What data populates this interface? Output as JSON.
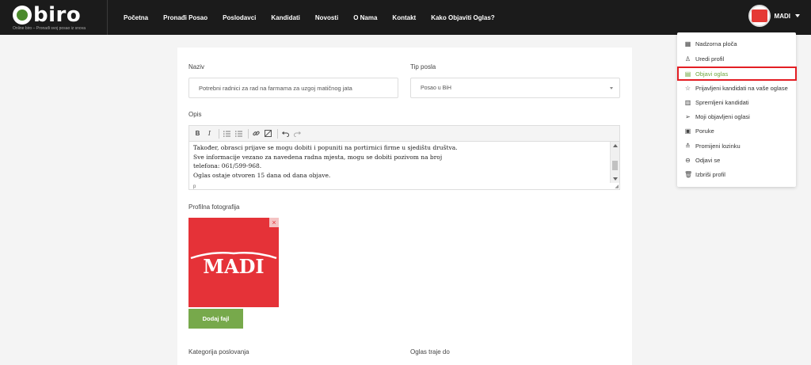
{
  "brand": {
    "name": "biro",
    "tagline": "Online biro – Pronađi svoj posao iz snova"
  },
  "nav": {
    "items": [
      "Početna",
      "Pronađi Posao",
      "Poslodavci",
      "Kandidati",
      "Novosti",
      "O Nama",
      "Kontakt",
      "Kako Objaviti Oglas?"
    ]
  },
  "user": {
    "name": "MADI"
  },
  "form": {
    "naziv_label": "Naziv",
    "naziv_value": "Potrebni radnici za rad na farmama za uzgoj matičnog jata",
    "tip_label": "Tip posla",
    "tip_value": "Posao u BiH",
    "opis_label": "Opis",
    "opis_lines": [
      "Također, obrasci prijave se mogu dobiti i popuniti na portirnici firme u sjedištu društva.",
      "Sve informacije vezano za navedena radna mjesta, mogu se dobiti pozivom na broj",
      "telefona: 061/599-968.",
      "Oglas ostaje otvoren 15 dana od dana objave."
    ],
    "editor_path": "p",
    "photo_label": "Profilna fotografija",
    "photo_logo_text": "MADI",
    "add_file_label": "Dodaj fajl",
    "kategorija_label": "Kategorija poslovanja",
    "trajanje_label": "Oglas traje do"
  },
  "toolbar": {
    "bold": "B",
    "italic": "I"
  },
  "menu": {
    "items": [
      {
        "label": "Nadzorna ploča",
        "icon": "dashboard-icon",
        "glyph": "▦"
      },
      {
        "label": "Uredi profil",
        "icon": "user-icon",
        "glyph": "♙"
      },
      {
        "label": "Objavi oglas",
        "icon": "post-icon",
        "glyph": "▤"
      },
      {
        "label": "Prijavljeni kandidati na vaše oglase",
        "icon": "star-icon",
        "glyph": "☆"
      },
      {
        "label": "Spremljeni kandidati",
        "icon": "saved-icon",
        "glyph": "▥"
      },
      {
        "label": "Moji objavljeni oglasi",
        "icon": "send-icon",
        "glyph": "➢"
      },
      {
        "label": "Poruke",
        "icon": "message-icon",
        "glyph": "▣"
      },
      {
        "label": "Promijeni lozinku",
        "icon": "lock-icon",
        "glyph": "≛"
      },
      {
        "label": "Odjavi se",
        "icon": "logout-icon",
        "glyph": "⊖"
      },
      {
        "label": "Izbriši profil",
        "icon": "trash-icon",
        "glyph": "🗑"
      }
    ],
    "active_index": 2
  },
  "colors": {
    "accent_green": "#77a94b",
    "highlight_red": "#e31e24",
    "topbar": "#1b1b1b",
    "logo_red": "#e53238"
  }
}
